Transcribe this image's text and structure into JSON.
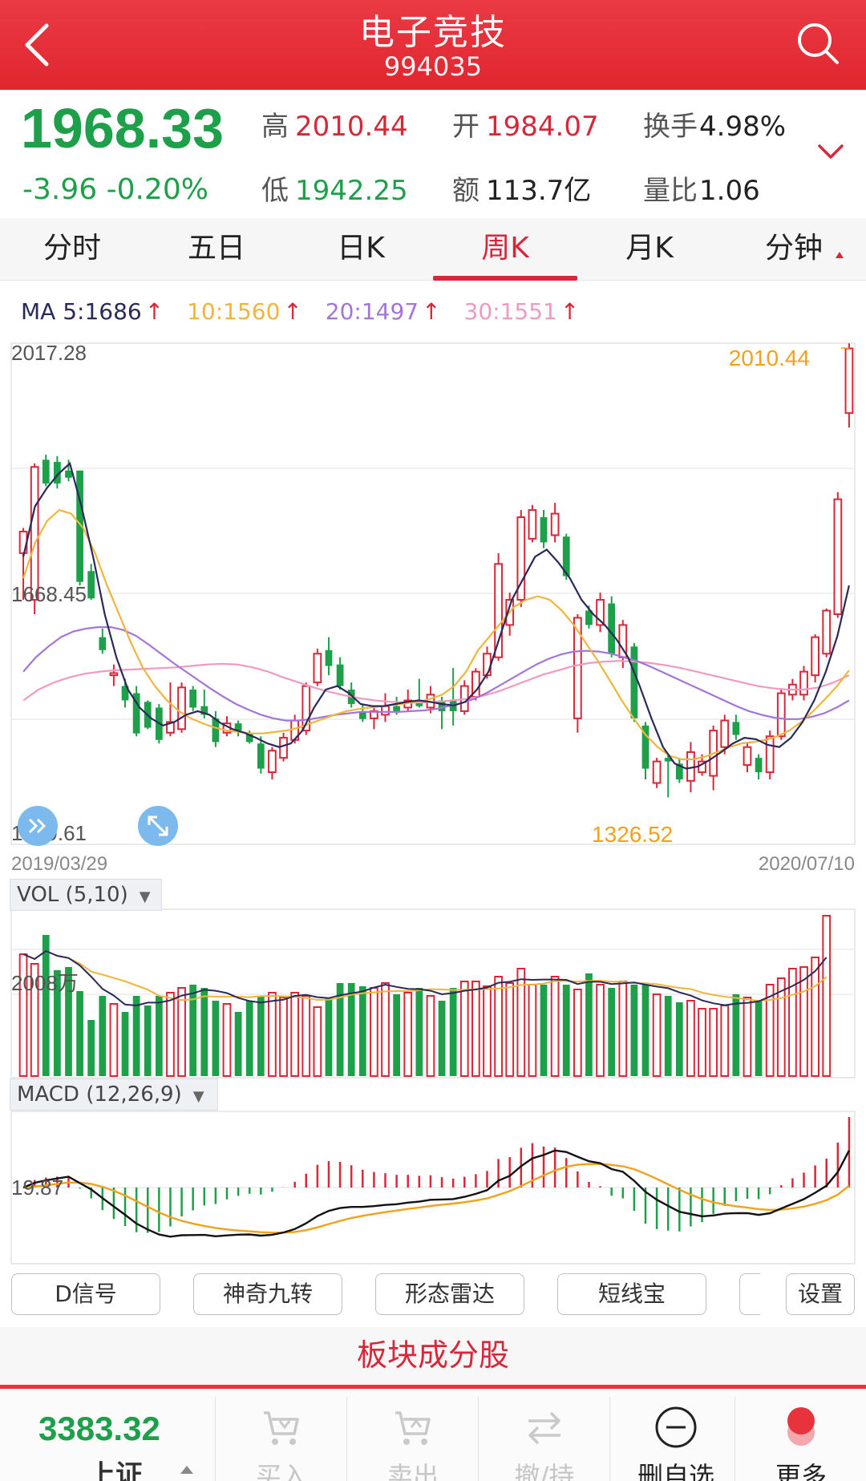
{
  "header": {
    "title": "电子竞技",
    "code": "994035",
    "back_icon": "chevron-left-icon",
    "search_icon": "search-icon"
  },
  "quote": {
    "price": "1968.33",
    "change": "-3.96 -0.20%",
    "high_label": "高",
    "high": "2010.44",
    "open_label": "开",
    "open": "1984.07",
    "turnover_label": "换手",
    "turnover": "4.98%",
    "low_label": "低",
    "low": "1942.25",
    "amount_label": "额",
    "amount": "113.7亿",
    "vol_ratio_label": "量比",
    "vol_ratio": "1.06"
  },
  "tabs": [
    {
      "label": "分时",
      "active": false
    },
    {
      "label": "五日",
      "active": false
    },
    {
      "label": "日K",
      "active": false
    },
    {
      "label": "周K",
      "active": true
    },
    {
      "label": "月K",
      "active": false
    },
    {
      "label": "分钟",
      "active": false
    }
  ],
  "ma_legend": [
    {
      "text": "MA 5:1686",
      "color": "#2a2a5a"
    },
    {
      "text": "10:1560",
      "color": "#f0b53c"
    },
    {
      "text": "20:1497",
      "color": "#a276d8"
    },
    {
      "text": "30:1551",
      "color": "#f09ac0"
    }
  ],
  "colors": {
    "up": "#d9273a",
    "down": "#1e9f4a",
    "ma5": "#2a2a5a",
    "ma10": "#f0b53c",
    "ma20": "#a276d8",
    "ma30": "#f09ac0",
    "accent": "#e0262f"
  },
  "chart_data": {
    "type": "candlestick",
    "price_axis": {
      "top": "2017.28",
      "mid": "1668.45",
      "bottom": "1319.61",
      "ylim": [
        1319.61,
        2017.28
      ]
    },
    "max_label": "2010.44",
    "min_label": "1326.52",
    "date_start": "2019/03/29",
    "date_end": "2020/07/10",
    "candles": [
      [
        1725,
        1755,
        1660,
        1760
      ],
      [
        1660,
        1845,
        1640,
        1850
      ],
      [
        1855,
        1822,
        1818,
        1862
      ],
      [
        1852,
        1822,
        1815,
        1860
      ],
      [
        1840,
        1830,
        1825,
        1855
      ],
      [
        1840,
        1685,
        1680,
        1840
      ],
      [
        1700,
        1662,
        1660,
        1710
      ],
      [
        1608,
        1590,
        1585,
        1620
      ],
      [
        1555,
        1558,
        1540,
        1570
      ],
      [
        1540,
        1520,
        1510,
        1550
      ],
      [
        1530,
        1474,
        1470,
        1540
      ],
      [
        1518,
        1482,
        1480,
        1520
      ],
      [
        1510,
        1465,
        1460,
        1515
      ],
      [
        1475,
        1490,
        1470,
        1545
      ],
      [
        1480,
        1538,
        1475,
        1545
      ],
      [
        1535,
        1510,
        1505,
        1540
      ],
      [
        1512,
        1500,
        1495,
        1535
      ],
      [
        1495,
        1462,
        1455,
        1505
      ],
      [
        1475,
        1488,
        1470,
        1498
      ],
      [
        1488,
        1478,
        1470,
        1492
      ],
      [
        1475,
        1462,
        1460,
        1478
      ],
      [
        1460,
        1425,
        1418,
        1470
      ],
      [
        1420,
        1450,
        1410,
        1455
      ],
      [
        1440,
        1468,
        1435,
        1475
      ],
      [
        1465,
        1492,
        1460,
        1500
      ],
      [
        1478,
        1540,
        1472,
        1545
      ],
      [
        1545,
        1585,
        1540,
        1592
      ],
      [
        1590,
        1568,
        1555,
        1608
      ],
      [
        1570,
        1540,
        1535,
        1580
      ],
      [
        1535,
        1515,
        1510,
        1545
      ],
      [
        1505,
        1494,
        1490,
        1515
      ],
      [
        1495,
        1505,
        1480,
        1510
      ],
      [
        1500,
        1512,
        1490,
        1530
      ],
      [
        1512,
        1505,
        1500,
        1525
      ],
      [
        1510,
        1520,
        1505,
        1535
      ],
      [
        1520,
        1512,
        1510,
        1550
      ],
      [
        1510,
        1528,
        1502,
        1540
      ],
      [
        1520,
        1505,
        1480,
        1525
      ],
      [
        1520,
        1505,
        1485,
        1565
      ],
      [
        1505,
        1540,
        1500,
        1548
      ],
      [
        1525,
        1560,
        1520,
        1565
      ],
      [
        1555,
        1585,
        1550,
        1595
      ],
      [
        1580,
        1710,
        1575,
        1725
      ],
      [
        1625,
        1660,
        1610,
        1670
      ],
      [
        1660,
        1775,
        1650,
        1785
      ],
      [
        1745,
        1785,
        1740,
        1792
      ],
      [
        1775,
        1740,
        1732,
        1785
      ],
      [
        1750,
        1780,
        1740,
        1795
      ],
      [
        1748,
        1693,
        1688,
        1752
      ],
      [
        1495,
        1635,
        1475,
        1640
      ],
      [
        1645,
        1625,
        1620,
        1652
      ],
      [
        1625,
        1660,
        1615,
        1670
      ],
      [
        1655,
        1585,
        1580,
        1665
      ],
      [
        1580,
        1625,
        1565,
        1632
      ],
      [
        1595,
        1495,
        1490,
        1600
      ],
      [
        1485,
        1425,
        1410,
        1490
      ],
      [
        1405,
        1435,
        1398,
        1440
      ],
      [
        1440,
        1435,
        1385,
        1445
      ],
      [
        1432,
        1410,
        1405,
        1438
      ],
      [
        1408,
        1448,
        1392,
        1462
      ],
      [
        1420,
        1435,
        1415,
        1445
      ],
      [
        1415,
        1478,
        1395,
        1485
      ],
      [
        1455,
        1492,
        1445,
        1500
      ],
      [
        1490,
        1472,
        1465,
        1500
      ],
      [
        1430,
        1455,
        1420,
        1462
      ],
      [
        1440,
        1420,
        1410,
        1445
      ],
      [
        1420,
        1470,
        1410,
        1478
      ],
      [
        1470,
        1530,
        1465,
        1535
      ],
      [
        1528,
        1542,
        1520,
        1550
      ],
      [
        1528,
        1560,
        1520,
        1568
      ],
      [
        1555,
        1608,
        1545,
        1612
      ],
      [
        1585,
        1645,
        1580,
        1648
      ],
      [
        1640,
        1800,
        1635,
        1810
      ],
      [
        1920,
        2010,
        1900,
        2017
      ]
    ],
    "ma5": [
      1720,
      1790,
      1815,
      1835,
      1850,
      1790,
      1720,
      1640,
      1580,
      1535,
      1510,
      1495,
      1485,
      1490,
      1500,
      1505,
      1500,
      1488,
      1480,
      1475,
      1468,
      1460,
      1455,
      1460,
      1478,
      1510,
      1535,
      1540,
      1530,
      1515,
      1512,
      1512,
      1515,
      1518,
      1520,
      1518,
      1515,
      1513,
      1518,
      1535,
      1560,
      1610,
      1660,
      1690,
      1720,
      1730,
      1712,
      1690,
      1660,
      1640,
      1625,
      1605,
      1580,
      1540,
      1495,
      1455,
      1432,
      1425,
      1428,
      1437,
      1448,
      1460,
      1468,
      1466,
      1458,
      1455,
      1468,
      1490,
      1520,
      1560,
      1610,
      1680
    ],
    "ma10": [
      1690,
      1740,
      1770,
      1785,
      1780,
      1760,
      1725,
      1680,
      1640,
      1600,
      1565,
      1540,
      1520,
      1505,
      1495,
      1488,
      1482,
      1478,
      1476,
      1474,
      1474,
      1476,
      1478,
      1482,
      1488,
      1494,
      1500,
      1505,
      1508,
      1510,
      1512,
      1514,
      1516,
      1518,
      1522,
      1528,
      1540,
      1560,
      1590,
      1610,
      1630,
      1650,
      1660,
      1665,
      1660,
      1645,
      1625,
      1600,
      1575,
      1548,
      1520,
      1495,
      1472,
      1455,
      1443,
      1438,
      1438,
      1442,
      1448,
      1455,
      1460,
      1462,
      1465,
      1470,
      1478,
      1490,
      1505,
      1522,
      1540,
      1562
    ],
    "ma20": [
      1560,
      1580,
      1595,
      1608,
      1616,
      1620,
      1622,
      1622,
      1618,
      1610,
      1598,
      1585,
      1572,
      1560,
      1548,
      1536,
      1525,
      1515,
      1507,
      1500,
      1495,
      1492,
      1492,
      1494,
      1497,
      1500,
      1502,
      1504,
      1504,
      1504,
      1504,
      1505,
      1506,
      1508,
      1512,
      1516,
      1522,
      1530,
      1540,
      1550,
      1560,
      1570,
      1578,
      1584,
      1588,
      1589,
      1588,
      1585,
      1580,
      1575,
      1568,
      1560,
      1552,
      1544,
      1536,
      1528,
      1520,
      1512,
      1505,
      1500,
      1496,
      1494,
      1494,
      1497,
      1502,
      1510,
      1520
    ],
    "ma30": [
      1520,
      1535,
      1545,
      1552,
      1557,
      1560,
      1562,
      1563,
      1564,
      1565,
      1566,
      1568,
      1570,
      1571,
      1570,
      1566,
      1560,
      1552,
      1545,
      1538,
      1532,
      1527,
      1523,
      1520,
      1518,
      1517,
      1517,
      1518,
      1520,
      1522,
      1526,
      1532,
      1540,
      1548,
      1556,
      1562,
      1568,
      1572,
      1574,
      1575,
      1574,
      1572,
      1569,
      1565,
      1560,
      1555,
      1550,
      1545,
      1540,
      1537,
      1535,
      1535,
      1538,
      1545,
      1555
    ],
    "volume": {
      "label": "VOL (5,10)",
      "axis_label": "2008万",
      "bars": [
        0.76,
        0.7,
        0.88,
        0.66,
        0.68,
        0.53,
        0.35,
        0.5,
        0.45,
        0.4,
        0.5,
        0.44,
        0.5,
        0.52,
        0.55,
        0.57,
        0.55,
        0.47,
        0.45,
        0.4,
        0.47,
        0.5,
        0.52,
        0.49,
        0.52,
        0.5,
        0.43,
        0.49,
        0.58,
        0.58,
        0.56,
        0.55,
        0.58,
        0.51,
        0.52,
        0.55,
        0.5,
        0.47,
        0.55,
        0.59,
        0.59,
        0.56,
        0.62,
        0.58,
        0.67,
        0.57,
        0.57,
        0.62,
        0.57,
        0.54,
        0.64,
        0.57,
        0.55,
        0.59,
        0.57,
        0.57,
        0.51,
        0.5,
        0.46,
        0.47,
        0.42,
        0.42,
        0.44,
        0.51,
        0.49,
        0.47,
        0.57,
        0.61,
        0.67,
        0.68,
        0.74,
        1.0
      ]
    },
    "macd": {
      "label": "MACD (12,26,9)",
      "axis_label": "19.87"
    }
  },
  "tools": [
    "D信号",
    "神奇九转",
    "形态雷达",
    "短线宝",
    "",
    "设置"
  ],
  "sector_label": "板块成分股",
  "bottom": {
    "index_value": "3383.32",
    "index_name": "上证",
    "items": [
      {
        "label": "买入",
        "icon": "buy-icon",
        "enabled": false
      },
      {
        "label": "卖出",
        "icon": "sell-icon",
        "enabled": false
      },
      {
        "label": "撤/持",
        "icon": "swap-icon",
        "enabled": false
      },
      {
        "label": "删自选",
        "icon": "remove-watchlist-icon",
        "enabled": true
      },
      {
        "label": "更多",
        "icon": "more-icon",
        "enabled": true
      }
    ]
  }
}
